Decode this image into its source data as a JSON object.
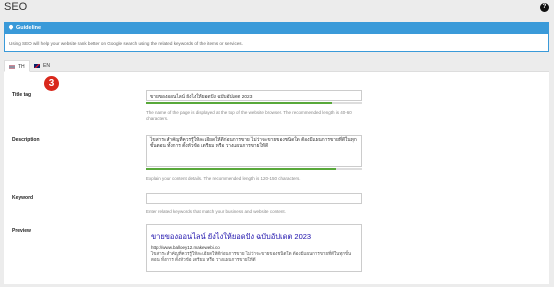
{
  "page": {
    "title": "SEO"
  },
  "guideline": {
    "title": "Guideline",
    "text": "Using SEO will help your website rank better on Google search using the related keywords of the items or services."
  },
  "tabs": [
    {
      "label": "TH",
      "active": true
    },
    {
      "label": "EN",
      "active": false
    }
  ],
  "step_badge": "3",
  "fields": {
    "title_tag": {
      "label": "Title tag",
      "value": "ขายของออนไลน์ ยังไงให้ยอดปัง ฉบับอัปเดต 2023",
      "progress": 0.86,
      "help": "The name of the page is displayed at the top of the website browser. The recommended length is 40-60 characters."
    },
    "description": {
      "label": "Description",
      "value": "ไขสาระสำคัญที่ควรรู้ให้ละเอียดให้ดีก่อนการขาย ไม่ว่าจะขายของชนิดใด ต้องมีแผนการขายที่ดีในทุกขั้นตอน ทั้งการ ตั้งหัวข้อ เตรียม หรือ วางแผนการขายให้ดี",
      "progress": 0.88,
      "help": "Explain your content details. The recommended length is 120-150 characters."
    },
    "keyword": {
      "label": "Keyword",
      "value": "",
      "help": "Enter related keywords that match your business and website content."
    },
    "preview": {
      "label": "Preview",
      "title": "ขายของออนไลน์ ยังไงให้ยอดปัง ฉบับอัปเดต 2023",
      "url": "http://www.balloey12.makewebi.co",
      "desc": "ไขสาระสำคัญที่ควรรู้ให้ละเอียดให้ดีก่อนการขาย ไม่ว่าจะขายของชนิดใด ต้องมีแผนการขายที่ดีในทุกขั้นตอน ทั้งการ ตั้งหัวข้อ เตรียม หรือ วางแผนการขายให้ดี"
    }
  },
  "colors": {
    "accent": "#3a9ad9",
    "progress": "#58a83a",
    "badge": "#d9281c"
  }
}
